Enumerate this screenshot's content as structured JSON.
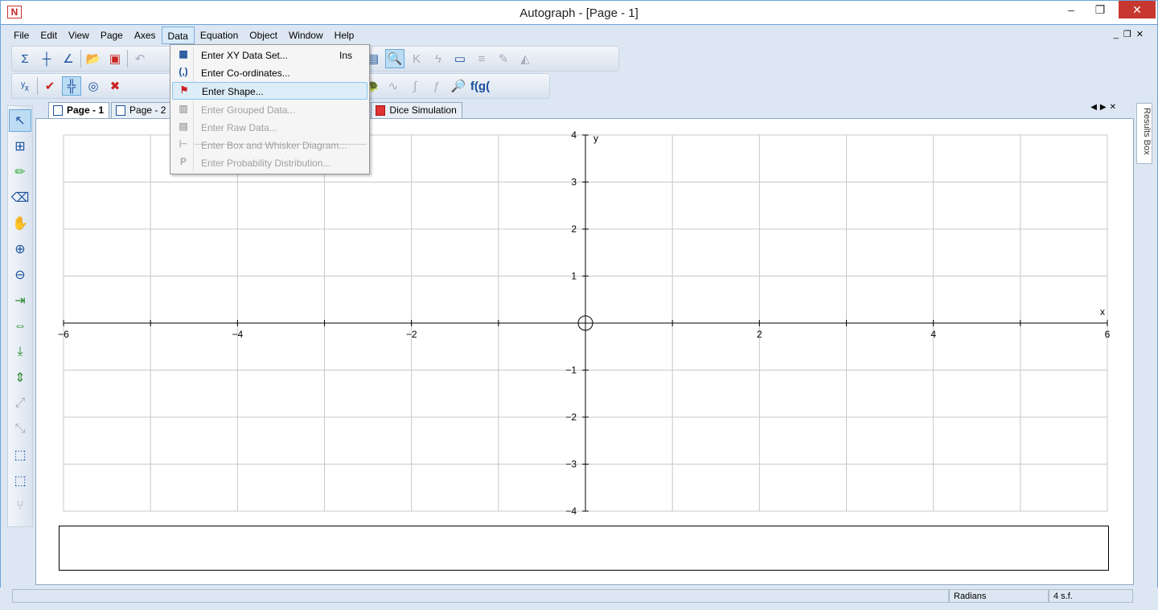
{
  "window": {
    "title": "Autograph - [Page - 1]",
    "logo": "N"
  },
  "menubar": [
    "File",
    "Edit",
    "View",
    "Page",
    "Axes",
    "Data",
    "Equation",
    "Object",
    "Window",
    "Help"
  ],
  "active_menu": "Data",
  "data_menu": [
    {
      "label": "Enter XY Data Set...",
      "shortcut": "Ins",
      "icon": "table-plus-icon",
      "enabled": true,
      "glyph": "▦"
    },
    {
      "label": "Enter Co-ordinates...",
      "icon": "coordinates-icon",
      "enabled": true,
      "glyph": "(,)"
    },
    {
      "label": "Enter Shape...",
      "icon": "flag-plus-icon",
      "enabled": true,
      "highlighted": true,
      "glyph": "⚑"
    },
    {
      "label": "Enter Grouped Data...",
      "icon": "grouped-data-icon",
      "enabled": false,
      "glyph": "▥"
    },
    {
      "label": "Enter Raw Data...",
      "icon": "raw-data-icon",
      "enabled": false,
      "glyph": "▤"
    },
    {
      "label": "Enter Box and Whisker Diagram...",
      "icon": "box-whisker-icon",
      "enabled": false,
      "glyph": "⊢"
    },
    {
      "label": "Enter Probability Distribution...",
      "icon": "probability-icon",
      "enabled": false,
      "glyph": "P"
    }
  ],
  "tabs": [
    {
      "label": "Page - 1",
      "active": true
    },
    {
      "label": "Page - 2"
    },
    {
      "label": "Dice Simulation"
    }
  ],
  "results_box": "Results Box",
  "graph": {
    "xlabel": "x",
    "ylabel": "y",
    "xmin": -6,
    "xmax": 6,
    "ymin": -4,
    "ymax": 4,
    "xticks": [
      "−6",
      "−4",
      "−2",
      "2",
      "4",
      "6"
    ],
    "yticks": [
      "4",
      "3",
      "2",
      "1",
      "−1",
      "−2",
      "−3",
      "−4"
    ]
  },
  "status": {
    "angle": "Radians",
    "precision": "4 s.f."
  }
}
